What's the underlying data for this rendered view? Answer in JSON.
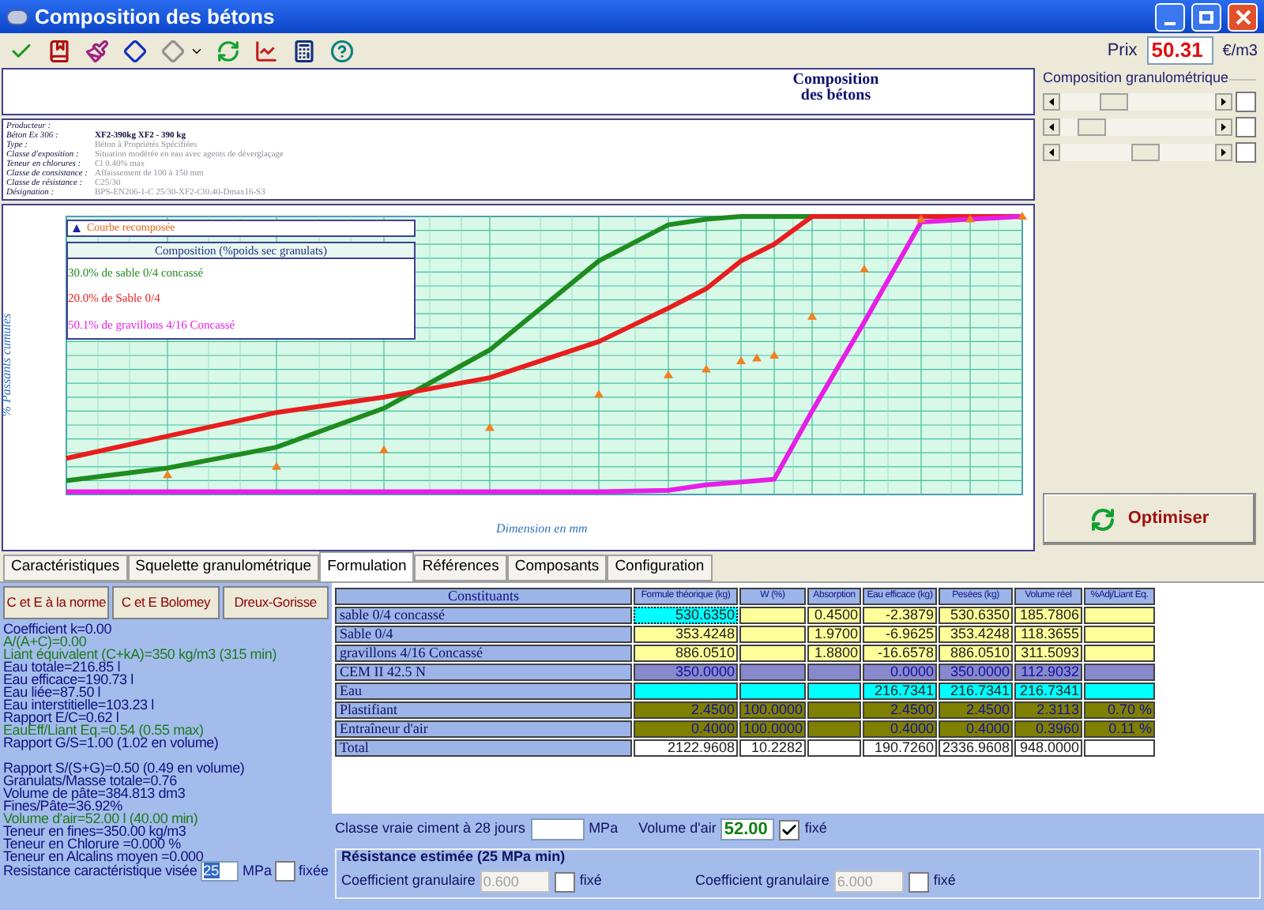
{
  "window": {
    "title": "Composition des bétons"
  },
  "price": {
    "label": "Prix",
    "value": "50.31",
    "unit": "€/m3"
  },
  "header": {
    "title": "Composition des bétons"
  },
  "info": [
    {
      "label": "Producteur :"
    },
    {
      "label": "Béton Ex 306 :",
      "value": "XF2-390kg XF2 - 390 kg",
      "bold": true
    },
    {
      "label": "Type :",
      "value": "Béton à Propriétés Spécifiées",
      "bold": false
    },
    {
      "label": "Classe d'exposition :",
      "value": "Situation modérée en eau avec agents de déverglaçage",
      "bold": false
    },
    {
      "label": "Teneur en chlorures :",
      "value": "Cl 0.40% max",
      "bold": false
    },
    {
      "label": "Classe de consistance :",
      "value": "Affaissement de 100 à 150 mm",
      "bold": false
    },
    {
      "label": "Classe de résistance :",
      "value": "C25/30",
      "bold": false
    },
    {
      "label": "Désignation :",
      "value": "BPS-EN206-1-C 25/30-XF2-Cl0.40-Dmax16-S3",
      "bold": false
    }
  ],
  "chart": {
    "ylabel": "% Passants cumulés",
    "xlabel": "Dimension en mm",
    "marker_legend": "Courbe recomposée",
    "legend_title": "Composition (%poids sec granulats)",
    "series": [
      {
        "name": "30.0% de sable 0/4 concassé",
        "color": "#1e8c1e"
      },
      {
        "name": "20.0% de Sable 0/4",
        "color": "#e81e1e"
      },
      {
        "name": "50.1% de gravillons 4/16 Concassé",
        "color": "#e61ee6"
      }
    ]
  },
  "granulo": {
    "title": "Composition granulométrique",
    "sliders": [
      {
        "level": 0.35,
        "checked": false
      },
      {
        "level": 0.2,
        "checked": false
      },
      {
        "level": 0.55,
        "checked": false
      }
    ]
  },
  "optimize_button": "Optimiser",
  "tabs": [
    {
      "label": "Caractéristiques",
      "selected": false
    },
    {
      "label": "Squelette granulométrique",
      "selected": false
    },
    {
      "label": "Formulation",
      "selected": true
    },
    {
      "label": "Références",
      "selected": false
    },
    {
      "label": "Composants",
      "selected": false
    },
    {
      "label": "Configuration",
      "selected": false
    }
  ],
  "methods": [
    "C et E à la norme",
    "C et E Bolomey",
    "Dreux-Gorisse"
  ],
  "results": [
    {
      "text": "Coefficient k=0.00",
      "color": "#101080"
    },
    {
      "text": "A/(A+C)=0.00",
      "color": "#1e7a1e"
    },
    {
      "text": "Liant équivalent (C+kA)=350 kg/m3 (315 min)",
      "color": "#1e7a1e"
    },
    {
      "text": "Eau totale=216.85 l",
      "color": "#101080"
    },
    {
      "text": "Eau efficace=190.73 l",
      "color": "#101080"
    },
    {
      "text": "Eau liée=87.50 l",
      "color": "#101080"
    },
    {
      "text": "Eau interstitielle=103.23 l",
      "color": "#101080"
    },
    {
      "text": "Rapport E/C=0.62 l",
      "color": "#101080"
    },
    {
      "text": "EauEff/Liant Eq.=0.54 (0.55 max)",
      "color": "#1e7a1e"
    },
    {
      "text": "Rapport G/S=1.00 (1.02 en volume)",
      "color": "#101080"
    },
    {
      "text": "Rapport S/(S+G)=0.50 (0.49 en volume)",
      "color": "#101080",
      "gap": true
    },
    {
      "text": "Granulats/Masse totale=0.76",
      "color": "#101080"
    },
    {
      "text": "Volume de pâte=384.813 dm3",
      "color": "#101080"
    },
    {
      "text": "Fines/Pâte=36.92%",
      "color": "#101080"
    },
    {
      "text": "Volume d'air=52.00 l (40.00 min)",
      "color": "#1e7a1e"
    },
    {
      "text": "Teneur en fines=350.00 kg/m3",
      "color": "#101080"
    },
    {
      "text": "Teneur en Chlorure =0.000 %",
      "color": "#101080"
    },
    {
      "text": "Teneur en Alcalins moyen =0.000",
      "color": "#101080"
    }
  ],
  "target": {
    "label": "Resistance caractéristique visée",
    "value": "25",
    "unit": "MPa",
    "checked": false,
    "check_label": "fixée"
  },
  "table": {
    "columns": [
      "Constituants",
      "Formule théorique (kg)",
      "W (%)",
      "Absorption",
      "Eau efficace (kg)",
      "Pesées (kg)",
      "Volume réel",
      "%Adj/Liant Eq."
    ],
    "rows": [
      {
        "color": "#ffff99",
        "current": true,
        "cells": [
          "sable 0/4 concassé",
          "530.6350",
          "",
          "0.4500",
          "-2.3879",
          "530.6350",
          "185.7806",
          ""
        ]
      },
      {
        "color": "#ffff99",
        "current": false,
        "cells": [
          "Sable 0/4",
          "353.4248",
          "",
          "1.9700",
          "-6.9625",
          "353.4248",
          "118.3655",
          ""
        ]
      },
      {
        "color": "#ffff99",
        "current": false,
        "cells": [
          "gravillons 4/16 Concassé",
          "886.0510",
          "",
          "1.8800",
          "-16.6578",
          "886.0510",
          "311.5093",
          ""
        ]
      },
      {
        "color": "#8888cc",
        "current": false,
        "cells": [
          "CEM II 42.5 N",
          "350.0000",
          "",
          "",
          "0.0000",
          "350.0000",
          "112.9032",
          ""
        ]
      },
      {
        "color": "#00ffff",
        "current": false,
        "cells": [
          "Eau",
          "",
          "",
          "",
          "216.7341",
          "216.7341",
          "216.7341",
          ""
        ]
      },
      {
        "color": "#808000",
        "current": false,
        "cells": [
          "Plastifiant",
          "2.4500",
          "100.0000",
          "",
          "2.4500",
          "2.4500",
          "2.3113",
          "0.70 %"
        ]
      },
      {
        "color": "#808000",
        "current": false,
        "cells": [
          "Entraîneur d'air",
          "0.4000",
          "100.0000",
          "",
          "0.4000",
          "0.4000",
          "0.3960",
          "0.11 %"
        ]
      },
      {
        "color": "#ffffff",
        "current": false,
        "cells": [
          "Total",
          "2122.9608",
          "10.2282",
          "",
          "190.7260",
          "2336.9608",
          "948.0000",
          ""
        ]
      }
    ]
  },
  "cement": {
    "label": "Classe vraie ciment à 28 jours",
    "unit": "MPa"
  },
  "air": {
    "label": "Volume d'air",
    "value": "52.00",
    "checked": true,
    "check_label": "fixé"
  },
  "strength": {
    "title": "Résistance estimée (25 MPa min)",
    "coefficients": [
      {
        "label": "Coefficient granulaire",
        "value": "0.600",
        "disabled": true,
        "checked": false,
        "check_label": "fixé"
      },
      {
        "label": "Coefficient granulaire",
        "value": "6.000",
        "disabled": true,
        "checked": false,
        "check_label": "fixé"
      }
    ]
  }
}
